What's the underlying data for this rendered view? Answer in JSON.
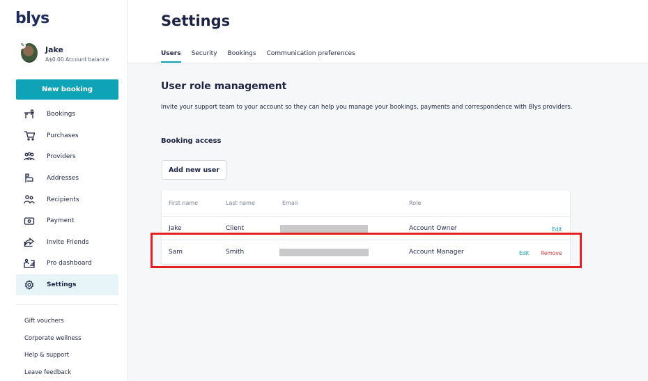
{
  "app": {
    "logo_text": "blys"
  },
  "profile": {
    "name": "Jake",
    "balance": "A$0.00 Account balance",
    "edit_glyph": "✎"
  },
  "sidebar": {
    "new_booking_label": "New booking",
    "items": [
      {
        "label": "Bookings",
        "icon": "massage-table-icon"
      },
      {
        "label": "Purchases",
        "icon": "cart-icon"
      },
      {
        "label": "Providers",
        "icon": "group-icon"
      },
      {
        "label": "Addresses",
        "icon": "mailbox-icon"
      },
      {
        "label": "Recipients",
        "icon": "users-icon"
      },
      {
        "label": "Payment",
        "icon": "card-icon"
      },
      {
        "label": "Invite Friends",
        "icon": "share-icon"
      },
      {
        "label": "Pro dashboard",
        "icon": "dashboard-icon"
      },
      {
        "label": "Settings",
        "icon": "gear-icon",
        "active": true
      }
    ],
    "footer": [
      "Gift vouchers",
      "Corporate wellness",
      "Help & support",
      "Leave feedback"
    ]
  },
  "main": {
    "title": "Settings",
    "tabs": [
      {
        "label": "Users",
        "active": true
      },
      {
        "label": "Security"
      },
      {
        "label": "Bookings"
      },
      {
        "label": "Communication preferences"
      }
    ],
    "section_title": "User role management",
    "section_desc": "Invite your support team to your account so they can help you manage your bookings, payments and correspondence with Blys providers.",
    "sub_title": "Booking access",
    "add_user_label": "Add new user",
    "table": {
      "headers": [
        "First name",
        "Last name",
        "Email",
        "Role"
      ],
      "rows": [
        {
          "first": "Jake",
          "last": "Client",
          "email_redacted": true,
          "role": "Account Owner",
          "edit": "Edit"
        },
        {
          "first": "Sam",
          "last": "Smith",
          "email_redacted": true,
          "role": "Account Manager",
          "edit": "Edit",
          "remove": "Remove"
        }
      ]
    }
  },
  "colors": {
    "accent": "#0fa3b8",
    "danger": "#d43b3b",
    "highlight": "#e32121",
    "text": "#1f2544"
  }
}
